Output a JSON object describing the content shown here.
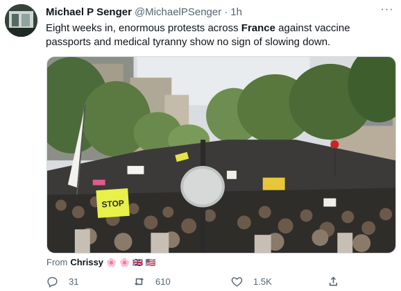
{
  "author": {
    "name": "Michael P Senger",
    "handle": "@MichaelPSenger",
    "separator": "·",
    "time": "1h"
  },
  "more_label": "···",
  "tweet": {
    "text_pre": "Eight weeks in, enormous protests across ",
    "text_bold": "France",
    "text_post": " against vaccine passports and medical tyranny show no sign of slowing down."
  },
  "media": {
    "sign_text": "STOP"
  },
  "attribution": {
    "prefix": "From",
    "name": "Chrissy",
    "emojis": [
      "🌸",
      "🌸",
      "🇬🇧",
      "🇺🇸"
    ]
  },
  "actions": {
    "replies": "31",
    "retweets": "610",
    "likes": "1.5K"
  },
  "colors": {
    "text": "#0f1419",
    "secondary": "#536471",
    "border": "#cfd9de"
  }
}
